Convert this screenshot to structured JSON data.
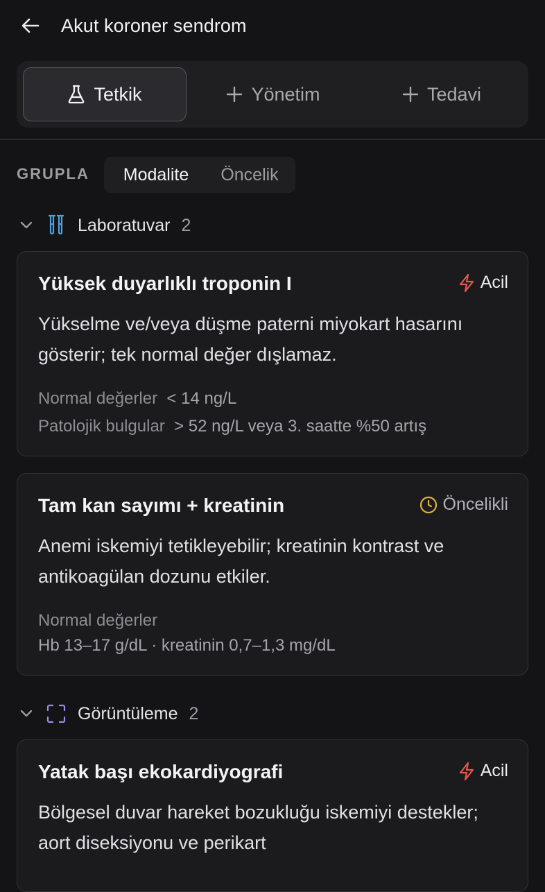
{
  "header": {
    "title": "Akut koroner sendrom",
    "back_icon": "arrow-left-icon"
  },
  "tabs": [
    {
      "label": "Tetkik",
      "icon": "flask-icon",
      "active": true
    },
    {
      "label": "Yönetim",
      "icon": "plus-icon",
      "active": false
    },
    {
      "label": "Tedavi",
      "icon": "plus-icon",
      "active": false
    }
  ],
  "group": {
    "label": "GRUPLA",
    "options": [
      {
        "label": "Modalite",
        "active": true
      },
      {
        "label": "Öncelik",
        "active": false
      }
    ]
  },
  "sections": [
    {
      "title": "Laboratuvar",
      "count": "2",
      "icon": "test-tubes-icon",
      "icon_color": "#4aa3e0",
      "cards": [
        {
          "title": "Yüksek duyarlıklı troponin I",
          "badge": {
            "label": "Acil",
            "icon": "lightning-icon",
            "color": "#e5574a"
          },
          "desc": "Yükselme ve/veya düşme paterni miyokart hasarını gösterir; tek normal değer dışlamaz.",
          "meta": [
            {
              "key": "Normal değerler",
              "value": "< 14 ng/L"
            },
            {
              "key": "Patolojik bulgular",
              "value": "> 52 ng/L veya 3. saatte %50 artış"
            }
          ]
        },
        {
          "title": "Tam kan sayımı + kreatinin",
          "badge": {
            "label": "Öncelikli",
            "icon": "clock-icon",
            "color": "#e0b23a"
          },
          "desc": "Anemi iskemiyi tetikleyebilir; kreatinin kontrast ve antikoagülan dozunu etkiler.",
          "meta": [
            {
              "key": "Normal değerler",
              "value": "Hb 13–17 g/dL · kreatinin 0,7–1,3 mg/dL"
            }
          ]
        }
      ]
    },
    {
      "title": "Görüntüleme",
      "count": "2",
      "icon": "scan-icon",
      "icon_color": "#9b8cf0",
      "cards": [
        {
          "title": "Yatak başı ekokardiyografi",
          "badge": {
            "label": "Acil",
            "icon": "lightning-icon",
            "color": "#e5574a"
          },
          "desc": "Bölgesel duvar hareket bozukluğu iskemiyi destekler; aort diseksiyonu ve perikart"
        }
      ]
    }
  ]
}
